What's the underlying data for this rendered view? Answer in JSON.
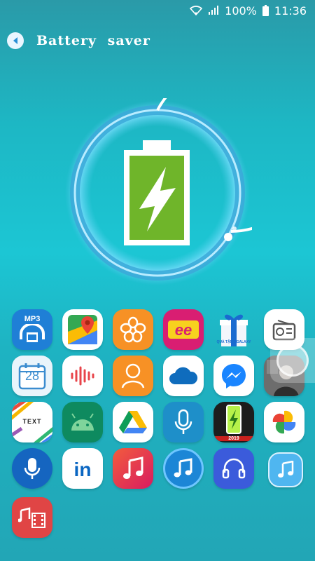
{
  "status_bar": {
    "battery_percent": "100%",
    "time": "11:36"
  },
  "header": {
    "title": "Battery  saver"
  },
  "battery": {
    "level": 1.0,
    "accent": "#6fb52a"
  },
  "apps": [
    {
      "name": "mp3-video-converter",
      "label": "MP3"
    },
    {
      "name": "google-maps",
      "label": ""
    },
    {
      "name": "flower-app",
      "label": ""
    },
    {
      "name": "ee-app",
      "label": "ee"
    },
    {
      "name": "quatang-galaxy",
      "label": "QUÀ TẶNG GALAXY"
    },
    {
      "name": "radio-app",
      "label": ""
    },
    {
      "name": "calendar",
      "label": "28"
    },
    {
      "name": "voice-recorder",
      "label": ""
    },
    {
      "name": "contacts",
      "label": ""
    },
    {
      "name": "onedrive",
      "label": ""
    },
    {
      "name": "messenger",
      "label": ""
    },
    {
      "name": "photo-app",
      "label": ""
    },
    {
      "name": "text-art",
      "label": "TEXT"
    },
    {
      "name": "android",
      "label": ""
    },
    {
      "name": "google-drive",
      "label": ""
    },
    {
      "name": "voice-input",
      "label": ""
    },
    {
      "name": "battery-charger",
      "label": "2019"
    },
    {
      "name": "google-photos",
      "label": ""
    },
    {
      "name": "voice-search",
      "label": ""
    },
    {
      "name": "linkedin",
      "label": "in"
    },
    {
      "name": "music-red",
      "label": ""
    },
    {
      "name": "music-blue",
      "label": ""
    },
    {
      "name": "headset",
      "label": ""
    },
    {
      "name": "music-light",
      "label": ""
    },
    {
      "name": "video-music-editor",
      "label": ""
    }
  ]
}
